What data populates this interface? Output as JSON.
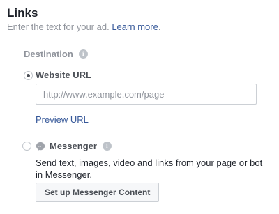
{
  "section": {
    "title": "Links",
    "subtitle": "Enter the text for your ad.",
    "learn_more": "Learn more",
    "period": "."
  },
  "destination": {
    "label": "Destination",
    "info_icon": "info-icon"
  },
  "website_option": {
    "label": "Website URL",
    "selected": true,
    "input_value": "",
    "input_placeholder": "http://www.example.com/page",
    "preview_link": "Preview URL"
  },
  "messenger_option": {
    "label": "Messenger",
    "selected": false,
    "icon": "messenger-icon",
    "description": "Send text, images, video and links from your page or bot in Messenger.",
    "button_label": "Set up Messenger Content"
  },
  "colors": {
    "link": "#365899",
    "muted": "#90949c",
    "border": "#ccd0d5",
    "button_bg": "#f6f7f9"
  }
}
